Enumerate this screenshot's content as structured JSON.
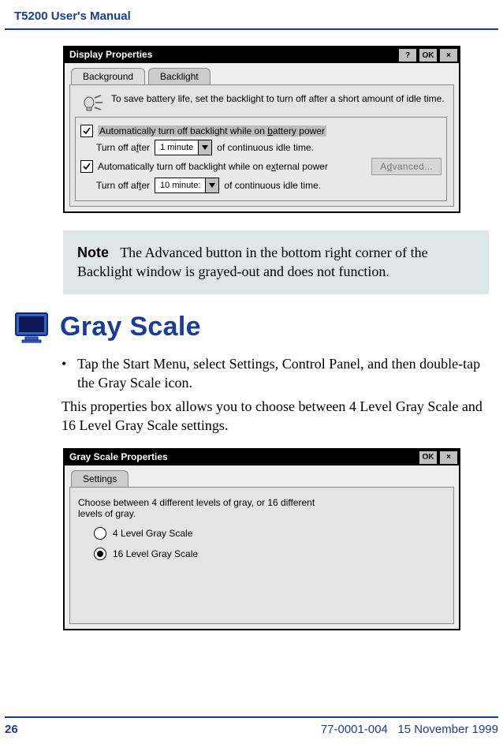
{
  "header": {
    "running_head": "T5200 User's Manual"
  },
  "display_props": {
    "title": "Display Properties",
    "help_btn": "?",
    "ok_btn": "OK",
    "close_btn": "×",
    "tab_background": "Background",
    "tab_backlight": "Backlight",
    "help_text": "To save battery life, set the backlight to turn off after a short amount of idle time.",
    "opt_battery_pre": "Automatically turn off backlight while on ",
    "opt_battery_u": "b",
    "opt_battery_post": "attery power",
    "turn_off_after_b_pre": "Turn off a",
    "turn_off_after_b_u": "f",
    "turn_off_after_b_post": "ter",
    "battery_value": "1 minute",
    "idle_suffix": " of continuous idle time.",
    "opt_ext_pre": "Automatically turn off backlight while on e",
    "opt_ext_u": "x",
    "opt_ext_post": "ternal power",
    "turn_off_after_e_pre": "Turn off af",
    "turn_off_after_e_u": "t",
    "turn_off_after_e_post": "er",
    "ext_value": "10 minute:",
    "adv_pre": "A",
    "adv_u": "d",
    "adv_post": "vanced..."
  },
  "note": {
    "label": "Note",
    "text": "The Advanced button in the bottom right corner of the Backlight window is grayed-out and does not function."
  },
  "section": {
    "title": "Gray Scale"
  },
  "body": {
    "bullet": "Tap the Start Menu, select Settings, Control Panel, and then double-tap the Gray Scale icon.",
    "para": "This properties box allows you to choose between 4 Level Gray Scale and 16 Level Gray Scale settings."
  },
  "gray_props": {
    "title": "Gray Scale Properties",
    "ok_btn": "OK",
    "close_btn": "×",
    "tab_settings": "Settings",
    "help_text": "Choose between 4 different levels of gray, or 16 different levels of gray.",
    "opt4": "4 Level Gray Scale",
    "opt16": "16 Level Gray Scale"
  },
  "footer": {
    "page_number": "26",
    "doc_id": "77-0001-004",
    "date": "15 November 1999"
  }
}
